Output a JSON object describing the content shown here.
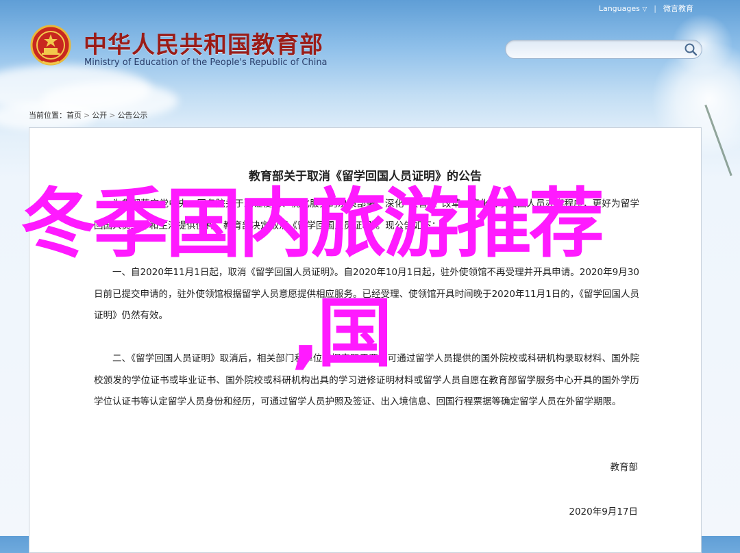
{
  "header": {
    "languages_label": "Languages",
    "languages_arrow": "▽",
    "weibo_label": "微言教育",
    "site_title": "中华人民共和国教育部",
    "site_subtitle": "Ministry of Education of the People's Republic of China"
  },
  "search": {
    "value": "",
    "placeholder": ""
  },
  "breadcrumb": {
    "prefix": "当前位置：",
    "items": [
      "首页",
      "公开",
      "公告公示"
    ],
    "separator": ">"
  },
  "document": {
    "title": "教育部关于取消《留学回国人员证明》的公告",
    "paragraph_1": "为贯彻落实党中央、国务院关于减证便民、优化服务的决策部署，深化“放管服”改革，简化留学回国人员办事程序，更好为留学回国人员工作和生活提供便利，教育部决定取消《留学回国人员证明》。现公告如下：",
    "paragraph_2": "一、自2020年11月1日起，取消《留学回国人员证明》。自2020年10月1日起，驻外使领馆不再受理并开具申请。2020年9月30日前已提交申请的，驻外使领馆根据留学人员意愿提供相应服务。已经受理、使领馆开具时间晚于2020年11月1日的，《留学回国人员证明》仍然有效。",
    "paragraph_3": "二、《留学回国人员证明》取消后，相关部门和单位根据实际需要，可通过留学人员提供的国外院校或科研机构录取材料、国外院校颁发的学位证书或毕业证书、国外院校或科研机构出具的学习进修证明材料或留学人员自愿在教育部留学服务中心开具的国外学历学位认证书等认定留学人员身份和经历，可通过留学人员护照及签证、出入境信息、回国行程票据等确定留学人员在外留学期限。",
    "signer": "教育部",
    "date": "2020年9月17日"
  },
  "overlay": {
    "line_1": "冬季国内旅游推荐",
    "line_2": ",国"
  },
  "colors": {
    "brand_red": "#9a1c18",
    "overlay_magenta": "#ff1aff",
    "sky_blue": "#5f9ed6"
  },
  "icons": {
    "logo": "national-emblem-icon",
    "search": "search-icon"
  }
}
